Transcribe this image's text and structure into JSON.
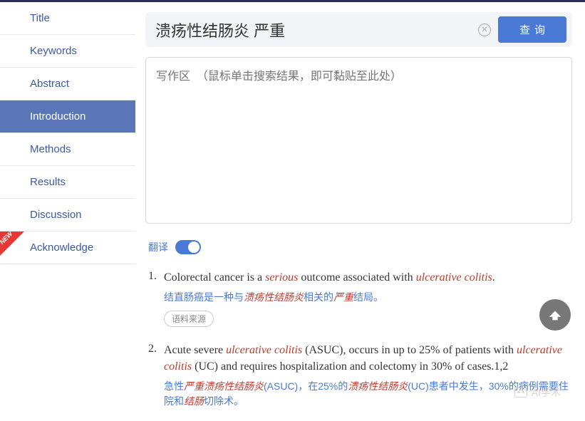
{
  "sidebar": {
    "items": [
      {
        "label": "Title",
        "active": false
      },
      {
        "label": "Keywords",
        "active": false
      },
      {
        "label": "Abstract",
        "active": false
      },
      {
        "label": "Introduction",
        "active": true
      },
      {
        "label": "Methods",
        "active": false
      },
      {
        "label": "Results",
        "active": false
      },
      {
        "label": "Discussion",
        "active": false
      },
      {
        "label": "Acknowledge",
        "active": false,
        "badge": "new"
      }
    ],
    "new_badge_text": "NEW"
  },
  "search": {
    "value": "溃疡性结肠炎 严重",
    "button": "查询"
  },
  "writing_area": {
    "placeholder": "写作区  （鼠标单击搜索结果，即可黏贴至此处）"
  },
  "translate": {
    "label": "翻译",
    "on": true
  },
  "results": [
    {
      "num": "1.",
      "en_html": "Colorectal cancer is a <em>serious</em> outcome associated with <em>ulcerative colitis</em>.",
      "cn_html": "结直肠癌是一种与<em>溃疡性结肠炎</em>相关的<em>严重</em>结局。",
      "source_label": "语料来源"
    },
    {
      "num": "2.",
      "en_html": "Acute severe <em>ulcerative colitis</em> (ASUC), occurs in up to 25% of patients with <em>ulcerative colitis</em> (UC) and requires hospitalization and colectomy in 30% of cases.1,2",
      "cn_html": "急性<em>严重溃疡性结肠炎</em>(ASUC)，在25%的<em>溃疡性结肠炎</em>(UC)患者中发生，30%的病例需要住院和<em>结肠</em>切除术。",
      "source_label": null
    }
  ],
  "watermark": "AI学术"
}
